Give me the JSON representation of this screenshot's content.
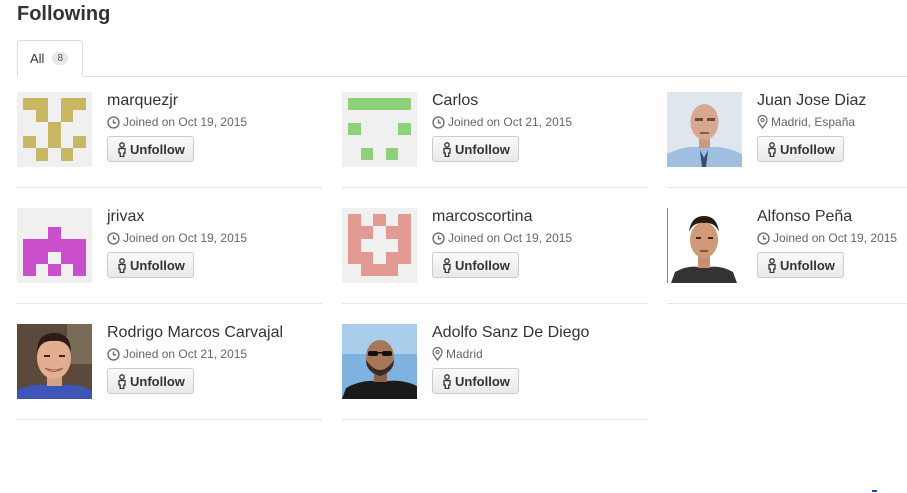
{
  "page_title": "Following",
  "tabs": [
    {
      "label": "All",
      "count": "8"
    }
  ],
  "button_label": "Unfollow",
  "users": [
    {
      "name": "marquezjr",
      "meta_icon": "clock-icon",
      "meta": "Joined on Oct 19, 2015",
      "avatar": "identicon-olive"
    },
    {
      "name": "Carlos",
      "meta_icon": "clock-icon",
      "meta": "Joined on Oct 21, 2015",
      "avatar": "identicon-green"
    },
    {
      "name": "Juan Jose Diaz",
      "meta_icon": "location-icon",
      "meta": "Madrid, España",
      "avatar": "photo"
    },
    {
      "name": "jrivax",
      "meta_icon": "clock-icon",
      "meta": "Joined on Oct 19, 2015",
      "avatar": "identicon-magenta"
    },
    {
      "name": "marcoscortina",
      "meta_icon": "clock-icon",
      "meta": "Joined on Oct 19, 2015",
      "avatar": "identicon-pink"
    },
    {
      "name": "Alfonso Peña",
      "meta_icon": "clock-icon",
      "meta": "Joined on Oct 19, 2015",
      "avatar": "photo"
    },
    {
      "name": "Rodrigo Marcos Carvajal",
      "meta_icon": "clock-icon",
      "meta": "Joined on Oct 21, 2015",
      "avatar": "photo"
    },
    {
      "name": "Adolfo Sanz De Diego",
      "meta_icon": "location-icon",
      "meta": "Madrid",
      "avatar": "photo"
    }
  ],
  "colors": {
    "olive": "#c8b864",
    "green": "#8fd07a",
    "magenta": "#c94fcb",
    "pink": "#e39a94",
    "link_blue": "#1a44cc"
  }
}
